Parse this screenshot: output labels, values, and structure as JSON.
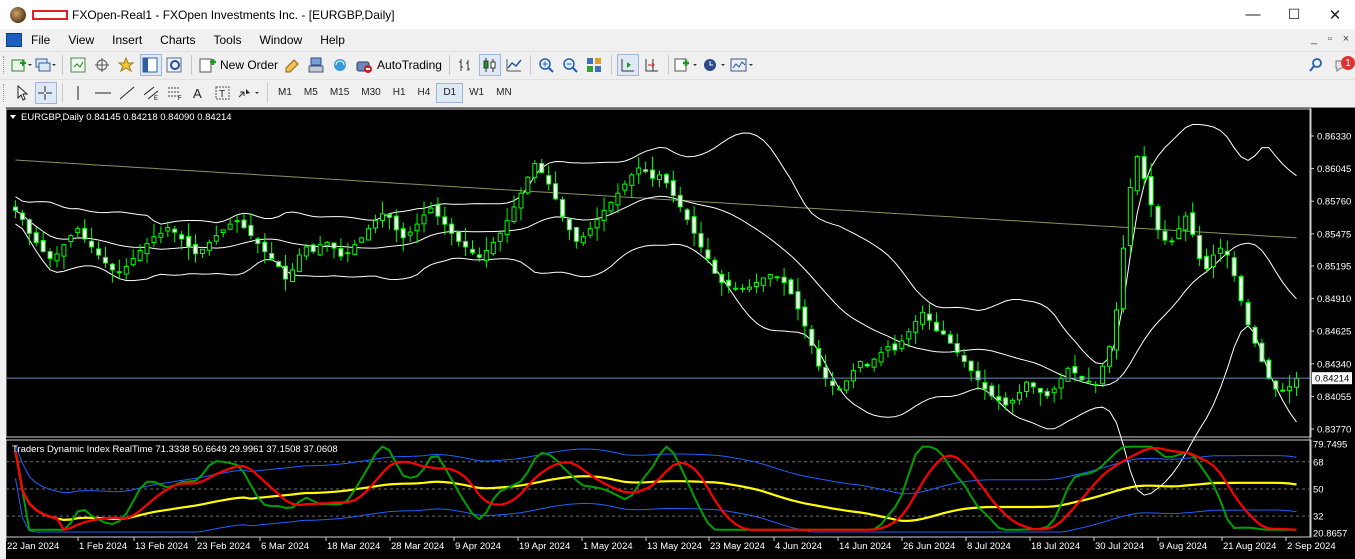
{
  "window": {
    "title": "FXOpen-Real1 - FXOpen Investments Inc. - [EURGBP,Daily]",
    "controls": [
      "—",
      "☐",
      "✕"
    ]
  },
  "menu": [
    "File",
    "View",
    "Insert",
    "Charts",
    "Tools",
    "Window",
    "Help"
  ],
  "mdi_controls": [
    "_",
    "▫",
    "×"
  ],
  "toolbar": {
    "new_order_label": "New Order",
    "autotrading_label": "AutoTrading",
    "notification_count": "1"
  },
  "timeframes": [
    "M1",
    "M5",
    "M15",
    "M30",
    "H1",
    "H4",
    "D1",
    "W1",
    "MN"
  ],
  "active_timeframe": "D1",
  "colors": {
    "chart_bg": "#000000",
    "candle": "#00ff00",
    "bollinger": "#ffffff",
    "ma_long": "#8f8f60",
    "tdi_blue": "#1e60ff",
    "tdi_yellow": "#ffff00",
    "tdi_red": "#ff0000",
    "tdi_green": "#00a000",
    "level_line": "#6e88b8"
  },
  "main_chart": {
    "header": "EURGBP,Daily  0.84145 0.84218 0.84090 0.84214",
    "current_price": "0.84214",
    "price_ticks": [
      "0.86330",
      "0.86045",
      "0.85760",
      "0.85475",
      "0.85195",
      "0.84910",
      "0.84625",
      "0.84340",
      "0.84055",
      "0.83770"
    ]
  },
  "indicator": {
    "header": "Traders Dynamic Index RealTime 71.3338 50.6649 29.9961 37.1508 37.0608",
    "scale_labels": [
      "79.7495",
      "68",
      "50",
      "32",
      "20.8657"
    ]
  },
  "chart_data": {
    "type": "candlestick",
    "symbol": "EURGBP",
    "timeframe": "Daily",
    "x_tick_labels": [
      "22 Jan 2024",
      "1 Feb 2024",
      "13 Feb 2024",
      "23 Feb 2024",
      "6 Mar 2024",
      "18 Mar 2024",
      "28 Mar 2024",
      "9 Apr 2024",
      "19 Apr 2024",
      "1 May 2024",
      "13 May 2024",
      "23 May 2024",
      "4 Jun 2024",
      "14 Jun 2024",
      "26 Jun 2024",
      "8 Jul 2024",
      "18 Jul 2024",
      "30 Jul 2024",
      "9 Aug 2024",
      "21 Aug 2024",
      "2 Sep 2024"
    ],
    "ylim": [
      0.8377,
      0.8633
    ],
    "close_series": [
      0.8568,
      0.856,
      0.8548,
      0.854,
      0.8532,
      0.8526,
      0.853,
      0.8538,
      0.8546,
      0.8552,
      0.8543,
      0.8536,
      0.8529,
      0.8522,
      0.8516,
      0.8514,
      0.8519,
      0.8526,
      0.8533,
      0.8539,
      0.8545,
      0.8548,
      0.8553,
      0.8549,
      0.8543,
      0.8536,
      0.853,
      0.8534,
      0.854,
      0.8546,
      0.8551,
      0.8556,
      0.8559,
      0.8553,
      0.8546,
      0.8539,
      0.8532,
      0.8526,
      0.8519,
      0.8508,
      0.8516,
      0.8529,
      0.8536,
      0.8532,
      0.8538,
      0.854,
      0.8535,
      0.8528,
      0.8531,
      0.8538,
      0.8544,
      0.8552,
      0.8559,
      0.8565,
      0.8562,
      0.8551,
      0.8544,
      0.8549,
      0.8556,
      0.8564,
      0.857,
      0.8563,
      0.8556,
      0.8548,
      0.8541,
      0.8536,
      0.8531,
      0.8527,
      0.8533,
      0.854,
      0.8548,
      0.8559,
      0.8571,
      0.8583,
      0.8597,
      0.8609,
      0.8601,
      0.8591,
      0.8578,
      0.8563,
      0.8551,
      0.8541,
      0.8545,
      0.8552,
      0.856,
      0.8568,
      0.8575,
      0.8583,
      0.8591,
      0.8599,
      0.8605,
      0.8602,
      0.8596,
      0.8599,
      0.8592,
      0.8581,
      0.8571,
      0.856,
      0.8548,
      0.8536,
      0.8526,
      0.8513,
      0.8505,
      0.8502,
      0.85,
      0.8499,
      0.8501,
      0.8505,
      0.8509,
      0.8512,
      0.851,
      0.8505,
      0.8495,
      0.8482,
      0.8467,
      0.845,
      0.8432,
      0.8421,
      0.8415,
      0.8412,
      0.8419,
      0.8428,
      0.8436,
      0.8432,
      0.8438,
      0.8444,
      0.8449,
      0.8446,
      0.8454,
      0.8462,
      0.8471,
      0.8479,
      0.8472,
      0.8463,
      0.846,
      0.8452,
      0.8444,
      0.8436,
      0.8428,
      0.842,
      0.8412,
      0.8406,
      0.8402,
      0.8398,
      0.8402,
      0.8409,
      0.8418,
      0.8414,
      0.8409,
      0.8406,
      0.8412,
      0.8421,
      0.843,
      0.8426,
      0.842,
      0.8418,
      0.8416,
      0.8432,
      0.8449,
      0.8481,
      0.8535,
      0.8588,
      0.8615,
      0.8596,
      0.8573,
      0.8551,
      0.8542,
      0.8541,
      0.8552,
      0.8563,
      0.8547,
      0.8526,
      0.8517,
      0.8529,
      0.8535,
      0.8529,
      0.8511,
      0.8489,
      0.8468,
      0.8452,
      0.8436,
      0.8421,
      0.8412,
      0.841,
      0.8414,
      0.8421
    ]
  }
}
